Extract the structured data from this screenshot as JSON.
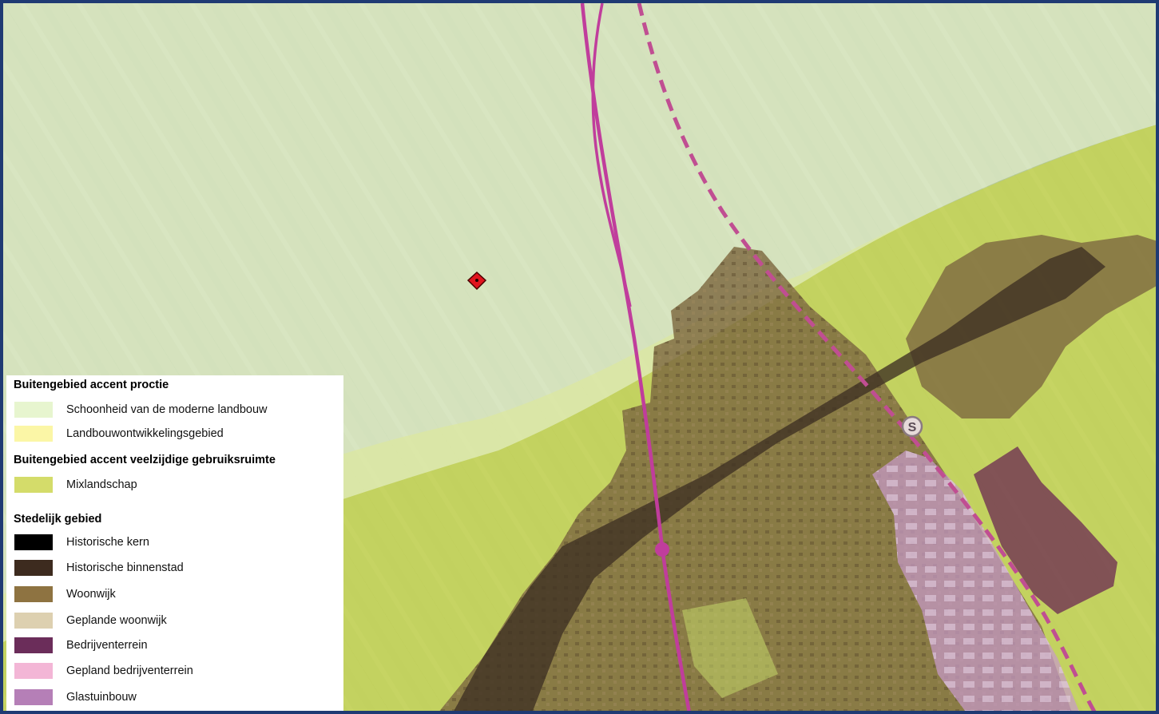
{
  "map": {
    "station_label": "S",
    "marker_icon": "location-marker-icon",
    "colors": {
      "aerial_base": "#b5c99a",
      "pale_overlay": "#e8f2d3",
      "mixlandschap": "#c9d64a",
      "woonwijk": "#7d6840",
      "historische_binnenstad": "#3d2f22",
      "bedrijventerrein": "#6e2e52",
      "glastuinbouw": "#c79ac9",
      "railway": "#c03d9c",
      "dashed_rail": "#c04e92",
      "marker": "#e0141e",
      "frame": "#1f3a73"
    }
  },
  "legend": {
    "sections": [
      {
        "title": "Buitengebied accent proctie",
        "items": [
          {
            "label": "Schoonheid van de moderne landbouw",
            "color": "#e7f5cf"
          },
          {
            "label": "Landbouwontwikkelingsgebied",
            "color": "#fbf6a6"
          }
        ]
      },
      {
        "title": "Buitengebied accent veelzijdige gebruiksruimte",
        "items": [
          {
            "label": "Mixlandschap",
            "color": "#d4dc6a"
          }
        ]
      },
      {
        "title": "Stedelijk gebied",
        "items": [
          {
            "label": "Historische kern",
            "color": "#000000"
          },
          {
            "label": "Historische binnenstad",
            "color": "#3d2b1f"
          },
          {
            "label": "Woonwijk",
            "color": "#8e7341"
          },
          {
            "label": "Geplande woonwijk",
            "color": "#ddd0b0"
          },
          {
            "label": "Bedrijventerrein",
            "color": "#6b2d5a"
          },
          {
            "label": "Gepland bedrijventerrein",
            "color": "#f3b6d6"
          },
          {
            "label": "Glastuinbouw",
            "color": "#b57fb7"
          }
        ]
      }
    ]
  }
}
